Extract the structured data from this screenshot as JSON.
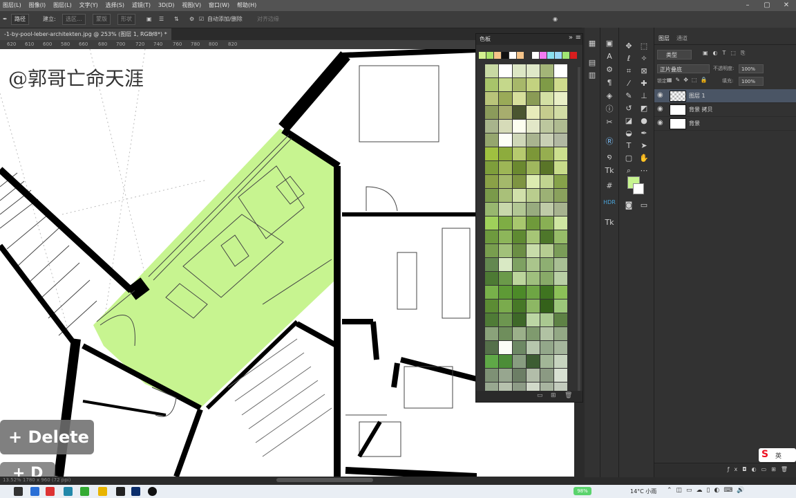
{
  "menu": [
    "图层(L)",
    "图像(I)",
    "图层(L)",
    "文字(Y)",
    "选择(S)",
    "滤镜(T)",
    "3D(D)",
    "视图(V)",
    "窗口(W)",
    "帮助(H)"
  ],
  "options": {
    "tool": "路径",
    "build": "建立:",
    "selection": "选区...",
    "mask": "蒙版",
    "shape": "形状",
    "auto_add": "自动添加/删除",
    "align_edges": "对齐边缘"
  },
  "document": {
    "tab": "-1-by-pool-leber-architekten.jpg @ 253% (图层 1, RGB/8*) *",
    "ruler": [
      "620",
      "610",
      "600",
      "580",
      "660",
      "680",
      "700",
      "720",
      "740",
      "760",
      "780",
      "800",
      "820"
    ],
    "watermark": "@郭哥亡命天涯",
    "status": "13.52% 1780 x 960 (72 ppi)"
  },
  "overlay": {
    "label1": "+ Delete",
    "label2": "+ D"
  },
  "swatches": {
    "title": "色板",
    "recent": [
      "#d3f090",
      "#a9e26a",
      "#f5c48a",
      "#111111",
      "#ffffff",
      "#f5c48a",
      "#333333",
      "#ffffff",
      "#f27bf2",
      "#8ae0ef",
      "#9bd8f8",
      "#a1e674",
      "#d81e1e"
    ],
    "grid": [
      "#c8d9a3",
      "#ffffff",
      "#dce6c4",
      "#dfe8c8",
      "#a3b578",
      "#ffffff",
      "#a8c46a",
      "#c5d88b",
      "#a7b86a",
      "#c3d280",
      "#7f9b47",
      "#cfdb8d",
      "#b9c47a",
      "#9aaa58",
      "#d7df9c",
      "#8a9b55",
      "#d3e0a4",
      "#e9efc6",
      "#8b9b5b",
      "#a7ad6e",
      "#4a5530",
      "#e7ebba",
      "#c5cc8e",
      "#d2dca5",
      "#a8b48c",
      "#d6dbb8",
      "#fdfef0",
      "#e2e7c8",
      "#bcc79e",
      "#afbb91",
      "#95a66e",
      "#fdfef8",
      "#cfd7b8",
      "#a9b48f",
      "#c9d0b5",
      "#b1b8a2",
      "#9fc040",
      "#8dac3d",
      "#b6ca6e",
      "#7c9738",
      "#96ae50",
      "#ccdf8e",
      "#7e9e3b",
      "#9db656",
      "#6b8930",
      "#a0b75e",
      "#5a7528",
      "#c8dc8a",
      "#8aa147",
      "#a4b96b",
      "#7e9442",
      "#dcebb0",
      "#c1d490",
      "#86a24a",
      "#7a9a4a",
      "#a9c079",
      "#d1e0aa",
      "#b9cd8e",
      "#9cb175",
      "#8aa15d",
      "#98b76f",
      "#c8d8ab",
      "#b2c794",
      "#98ac7f",
      "#bfcba8",
      "#a7b38f",
      "#9fd05a",
      "#7ead44",
      "#a8c76e",
      "#6f9a3b",
      "#89b054",
      "#cfe6a2",
      "#6e9a3e",
      "#8db65a",
      "#5f8a32",
      "#a6c576",
      "#4e772a",
      "#97bc69",
      "#789e4e",
      "#a2c17a",
      "#6b8e44",
      "#c8dcaa",
      "#b6cd92",
      "#7a9c58",
      "#638850",
      "#d9e9c4",
      "#7ea162",
      "#aac58c",
      "#8eaf72",
      "#a8bf94",
      "#4d7a34",
      "#6b9a4a",
      "#bcd59c",
      "#9fbf7e",
      "#88aa68",
      "#b9cfa5",
      "#78b14a",
      "#5e9a36",
      "#4c8a28",
      "#6ea544",
      "#3f7420",
      "#8cc058",
      "#5c8c34",
      "#7aab4d",
      "#477827",
      "#8db764",
      "#34611a",
      "#9cc77a",
      "#4f7b36",
      "#6d9650",
      "#3e6828",
      "#bcd6a4",
      "#aac891",
      "#5e8245",
      "#8aa27a",
      "#6f8e5c",
      "#9bb08a",
      "#7f9a6e",
      "#b1c2a3",
      "#93a885",
      "#55704a",
      "#fbfdf6",
      "#6d8864",
      "#b6c7ad",
      "#93a78a",
      "#a5b69c",
      "#5fa847",
      "#4c8d38",
      "#889d80",
      "#3d5d33",
      "#a2b697",
      "#c7d4bf",
      "#7e9175",
      "#97a68f",
      "#6c7e65",
      "#b2bda9",
      "#8b9a83",
      "#d8e0d2",
      "#98a890",
      "#b6c1ad",
      "#8d9b86",
      "#d1d9c9",
      "#a8b4a0",
      "#c3cbbd"
    ]
  },
  "layers_panel": {
    "tab1": "图层",
    "tab2": "通道",
    "filter": "类型",
    "blend": "正片叠底",
    "opacity_label": "不透明度:",
    "opacity": "100%",
    "lock_label": "锁定:",
    "fill_label": "填充:",
    "fill": "100%",
    "layers": [
      {
        "name": "图层 1",
        "selected": true
      },
      {
        "name": "背景 拷贝",
        "selected": false
      },
      {
        "name": "背景",
        "selected": false
      }
    ]
  },
  "ime": {
    "label": "英"
  },
  "taskbar": {
    "battery": "98%",
    "weather": "14°C 小雨"
  },
  "colors": {
    "highlight": "#c7f490",
    "foreground": "#c7f490",
    "background": "#ffffff"
  }
}
